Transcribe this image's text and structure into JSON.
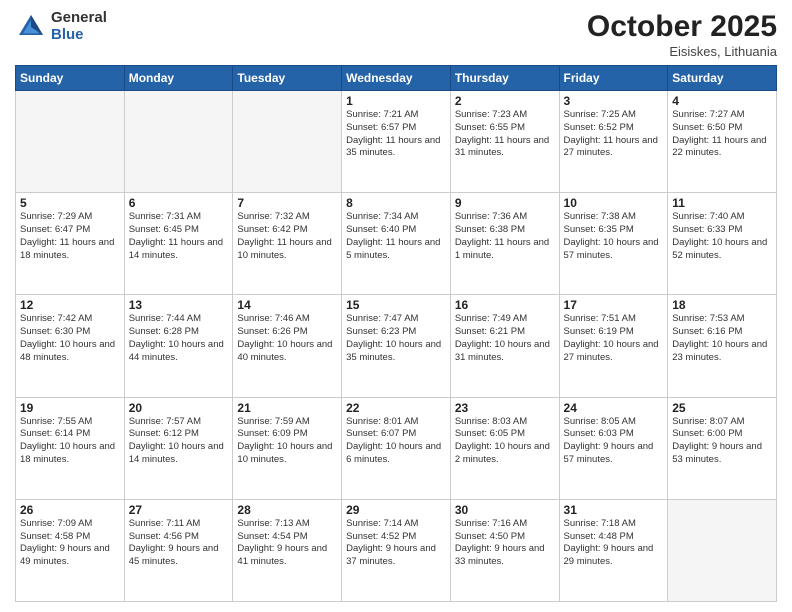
{
  "header": {
    "logo_general": "General",
    "logo_blue": "Blue",
    "month_title": "October 2025",
    "subtitle": "Eisiskes, Lithuania"
  },
  "days_of_week": [
    "Sunday",
    "Monday",
    "Tuesday",
    "Wednesday",
    "Thursday",
    "Friday",
    "Saturday"
  ],
  "weeks": [
    [
      {
        "day": "",
        "empty": true
      },
      {
        "day": "",
        "empty": true
      },
      {
        "day": "",
        "empty": true
      },
      {
        "day": "1",
        "sunrise": "7:21 AM",
        "sunset": "6:57 PM",
        "daylight": "11 hours and 35 minutes."
      },
      {
        "day": "2",
        "sunrise": "7:23 AM",
        "sunset": "6:55 PM",
        "daylight": "11 hours and 31 minutes."
      },
      {
        "day": "3",
        "sunrise": "7:25 AM",
        "sunset": "6:52 PM",
        "daylight": "11 hours and 27 minutes."
      },
      {
        "day": "4",
        "sunrise": "7:27 AM",
        "sunset": "6:50 PM",
        "daylight": "11 hours and 22 minutes."
      }
    ],
    [
      {
        "day": "5",
        "sunrise": "7:29 AM",
        "sunset": "6:47 PM",
        "daylight": "11 hours and 18 minutes."
      },
      {
        "day": "6",
        "sunrise": "7:31 AM",
        "sunset": "6:45 PM",
        "daylight": "11 hours and 14 minutes."
      },
      {
        "day": "7",
        "sunrise": "7:32 AM",
        "sunset": "6:42 PM",
        "daylight": "11 hours and 10 minutes."
      },
      {
        "day": "8",
        "sunrise": "7:34 AM",
        "sunset": "6:40 PM",
        "daylight": "11 hours and 5 minutes."
      },
      {
        "day": "9",
        "sunrise": "7:36 AM",
        "sunset": "6:38 PM",
        "daylight": "11 hours and 1 minute."
      },
      {
        "day": "10",
        "sunrise": "7:38 AM",
        "sunset": "6:35 PM",
        "daylight": "10 hours and 57 minutes."
      },
      {
        "day": "11",
        "sunrise": "7:40 AM",
        "sunset": "6:33 PM",
        "daylight": "10 hours and 52 minutes."
      }
    ],
    [
      {
        "day": "12",
        "sunrise": "7:42 AM",
        "sunset": "6:30 PM",
        "daylight": "10 hours and 48 minutes."
      },
      {
        "day": "13",
        "sunrise": "7:44 AM",
        "sunset": "6:28 PM",
        "daylight": "10 hours and 44 minutes."
      },
      {
        "day": "14",
        "sunrise": "7:46 AM",
        "sunset": "6:26 PM",
        "daylight": "10 hours and 40 minutes."
      },
      {
        "day": "15",
        "sunrise": "7:47 AM",
        "sunset": "6:23 PM",
        "daylight": "10 hours and 35 minutes."
      },
      {
        "day": "16",
        "sunrise": "7:49 AM",
        "sunset": "6:21 PM",
        "daylight": "10 hours and 31 minutes."
      },
      {
        "day": "17",
        "sunrise": "7:51 AM",
        "sunset": "6:19 PM",
        "daylight": "10 hours and 27 minutes."
      },
      {
        "day": "18",
        "sunrise": "7:53 AM",
        "sunset": "6:16 PM",
        "daylight": "10 hours and 23 minutes."
      }
    ],
    [
      {
        "day": "19",
        "sunrise": "7:55 AM",
        "sunset": "6:14 PM",
        "daylight": "10 hours and 18 minutes."
      },
      {
        "day": "20",
        "sunrise": "7:57 AM",
        "sunset": "6:12 PM",
        "daylight": "10 hours and 14 minutes."
      },
      {
        "day": "21",
        "sunrise": "7:59 AM",
        "sunset": "6:09 PM",
        "daylight": "10 hours and 10 minutes."
      },
      {
        "day": "22",
        "sunrise": "8:01 AM",
        "sunset": "6:07 PM",
        "daylight": "10 hours and 6 minutes."
      },
      {
        "day": "23",
        "sunrise": "8:03 AM",
        "sunset": "6:05 PM",
        "daylight": "10 hours and 2 minutes."
      },
      {
        "day": "24",
        "sunrise": "8:05 AM",
        "sunset": "6:03 PM",
        "daylight": "9 hours and 57 minutes."
      },
      {
        "day": "25",
        "sunrise": "8:07 AM",
        "sunset": "6:00 PM",
        "daylight": "9 hours and 53 minutes."
      }
    ],
    [
      {
        "day": "26",
        "sunrise": "7:09 AM",
        "sunset": "4:58 PM",
        "daylight": "9 hours and 49 minutes."
      },
      {
        "day": "27",
        "sunrise": "7:11 AM",
        "sunset": "4:56 PM",
        "daylight": "9 hours and 45 minutes."
      },
      {
        "day": "28",
        "sunrise": "7:13 AM",
        "sunset": "4:54 PM",
        "daylight": "9 hours and 41 minutes."
      },
      {
        "day": "29",
        "sunrise": "7:14 AM",
        "sunset": "4:52 PM",
        "daylight": "9 hours and 37 minutes."
      },
      {
        "day": "30",
        "sunrise": "7:16 AM",
        "sunset": "4:50 PM",
        "daylight": "9 hours and 33 minutes."
      },
      {
        "day": "31",
        "sunrise": "7:18 AM",
        "sunset": "4:48 PM",
        "daylight": "9 hours and 29 minutes."
      },
      {
        "day": "",
        "empty": true
      }
    ]
  ]
}
